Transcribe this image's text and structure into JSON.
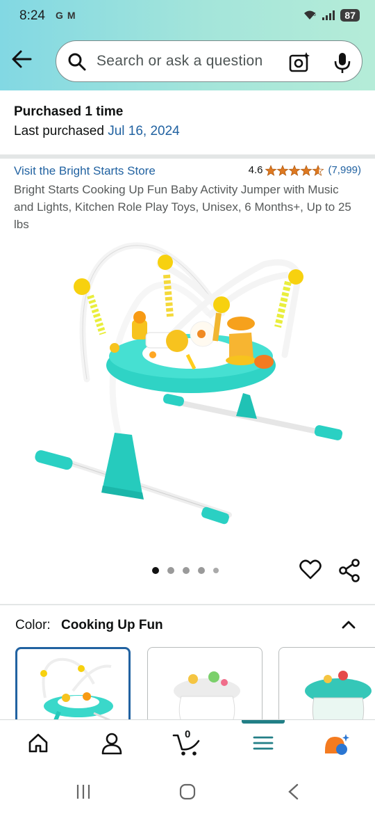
{
  "status": {
    "time": "8:24",
    "notif_icons": [
      "G",
      "M"
    ],
    "wifi_label": "◠",
    "battery": "87"
  },
  "search": {
    "placeholder": "Search or ask a question"
  },
  "purchase": {
    "bought": "Purchased 1 time",
    "last_label": "Last purchased",
    "last_date": "Jul 16, 2024"
  },
  "product": {
    "store": "Visit the Bright Starts Store",
    "rating_value": "4.6",
    "rating_count": "(7,999)",
    "rating": 4.6,
    "title": "Bright Starts Cooking Up Fun Baby Activity Jumper with Music and Lights, Kitchen Role Play Toys, Unisex, 6 Months+, Up to 25 lbs",
    "image_count": 5,
    "active_image": 0
  },
  "color": {
    "label": "Color:",
    "value": "Cooking Up Fun"
  },
  "bottom_nav": {
    "cart_count": "0",
    "active": "menu"
  },
  "colors": {
    "link": "#2162a1",
    "star": "#de7921",
    "accent": "#227f86"
  }
}
